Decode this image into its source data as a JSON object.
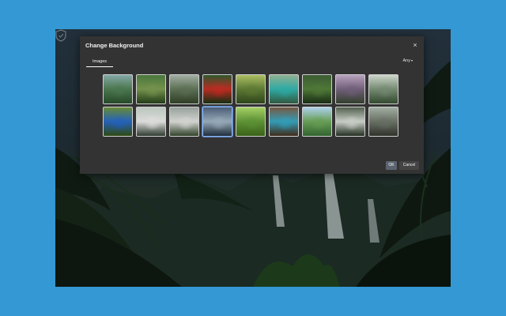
{
  "dialog": {
    "title": "Change Background",
    "close_label": "×",
    "tab_label": "Images",
    "filter_label": "Any",
    "ok_label": "OK",
    "cancel_label": "Cancel"
  },
  "thumbnails": [
    {
      "name": "thumb-valley-mist",
      "top": "#7aa1a0",
      "mid": "#4a7c4e",
      "bottom": "#2f5a32"
    },
    {
      "name": "thumb-monkey",
      "top": "#3a6b2c",
      "mid": "#7a9b4c",
      "bottom": "#2b4a1f"
    },
    {
      "name": "thumb-waterfall-rocks",
      "top": "#9ba79b",
      "mid": "#5c7454",
      "bottom": "#3a4c2e"
    },
    {
      "name": "thumb-parrot",
      "top": "#1d4a1c",
      "mid": "#c8261c",
      "bottom": "#1a3a17"
    },
    {
      "name": "thumb-forest-path",
      "top": "#a5b955",
      "mid": "#5e7f2f",
      "bottom": "#3a5421"
    },
    {
      "name": "thumb-turquoise-lake",
      "top": "#87a987",
      "mid": "#2bb7b0",
      "bottom": "#3c6d50"
    },
    {
      "name": "thumb-dark-jungle",
      "top": "#2b4e22",
      "mid": "#4e7d33",
      "bottom": "#1e3618"
    },
    {
      "name": "thumb-sunset-forest",
      "top": "#b29ab8",
      "mid": "#75617e",
      "bottom": "#3e4d37"
    },
    {
      "name": "thumb-foggy-trees",
      "top": "#c9d3c6",
      "mid": "#7a9277",
      "bottom": "#3f5a3a"
    },
    {
      "name": "thumb-blue-frog",
      "top": "#5c8124",
      "mid": "#1f64c8",
      "bottom": "#3a5a17"
    },
    {
      "name": "thumb-rapids",
      "top": "#b4c1b8",
      "mid": "#f0f0ee",
      "bottom": "#3b4a3d"
    },
    {
      "name": "thumb-waterfall-wide",
      "top": "#8d9891",
      "mid": "#e4e6e2",
      "bottom": "#3d5335"
    },
    {
      "name": "thumb-night-waterfall",
      "top": "#3a4f6a",
      "mid": "#9fb5c6",
      "bottom": "#27394b"
    },
    {
      "name": "thumb-chameleon",
      "top": "#9ccb57",
      "mid": "#5f9b31",
      "bottom": "#47781f"
    },
    {
      "name": "thumb-blue-pool",
      "top": "#6b4a32",
      "mid": "#2fa7c4",
      "bottom": "#4e3623"
    },
    {
      "name": "thumb-river-bank",
      "top": "#a7cdea",
      "mid": "#6aa856",
      "bottom": "#3e7a3a"
    },
    {
      "name": "thumb-tall-falls",
      "top": "#43513f",
      "mid": "#d9dfd6",
      "bottom": "#2d3a29"
    },
    {
      "name": "thumb-river-boulders",
      "top": "#9aa79a",
      "mid": "#6b7466",
      "bottom": "#3a3f36"
    }
  ],
  "selected_index": 12
}
